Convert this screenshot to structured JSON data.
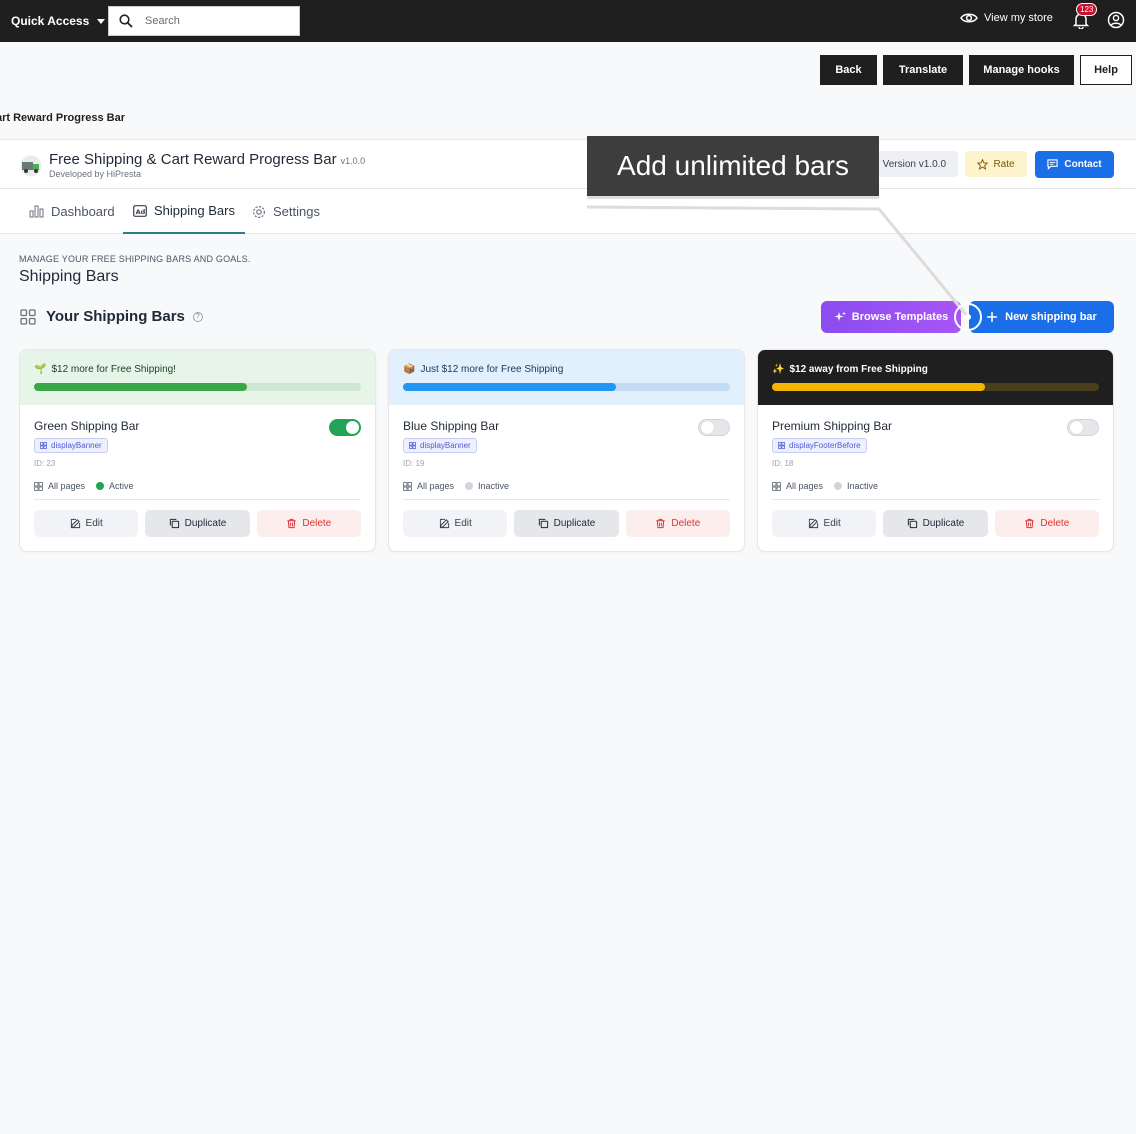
{
  "topbar": {
    "quick_access": "Quick Access",
    "search_placeholder": "Search",
    "view_store": "View my store",
    "notif_count": "123"
  },
  "toolbar": {
    "back": "Back",
    "translate": "Translate",
    "manage_hooks": "Manage hooks",
    "help": "Help"
  },
  "breadcrumb": "art Reward Progress Bar",
  "module": {
    "title": "Free Shipping & Cart Reward Progress Bar",
    "version": "v1.0.0",
    "developer": "Developed by HiPresta",
    "version_pill": "Version v1.0.0",
    "rate": "Rate",
    "contact": "Contact"
  },
  "tabs": [
    {
      "label": "Dashboard",
      "icon": "bar-chart-icon",
      "active": false
    },
    {
      "label": "Shipping Bars",
      "icon": "ad-icon",
      "active": true
    },
    {
      "label": "Settings",
      "icon": "gear-icon",
      "active": false
    }
  ],
  "section": {
    "kicker": "MANAGE YOUR FREE SHIPPING BARS AND GOALS.",
    "title": "Shipping Bars",
    "list_title": "Your Shipping Bars",
    "browse_templates": "Browse Templates",
    "new_bar": "New shipping bar"
  },
  "callout": "Add unlimited bars",
  "bars": [
    {
      "preview_text": "$12 more for Free Shipping!",
      "preview_emoji": "🌱",
      "progress": 0.65,
      "preview_bg": "#e6f5e8",
      "track_color": "#cfe6d2",
      "fill_color": "#3aa64a",
      "text_color": "#1f3d22",
      "name": "Green Shipping Bar",
      "hook": "displayBanner",
      "id": "ID: 23",
      "pages": "All pages",
      "status": "Active",
      "status_color": "#22a356",
      "enabled": true
    },
    {
      "preview_text": "Just $12 more for Free Shipping",
      "preview_emoji": "📦",
      "progress": 0.65,
      "preview_bg": "#e1f0fc",
      "track_color": "#c3dcf3",
      "fill_color": "#2196f3",
      "text_color": "#123a5e",
      "name": "Blue Shipping Bar",
      "hook": "displayBanner",
      "id": "ID: 19",
      "pages": "All pages",
      "status": "Inactive",
      "status_color": "#d1d5db",
      "enabled": false
    },
    {
      "preview_text": "$12 away from Free Shipping",
      "preview_emoji": "✨",
      "progress": 0.65,
      "preview_bg": "#1f1f1f",
      "track_color": "#4a3f1c",
      "fill_color": "#f4b400",
      "text_color": "#ffffff",
      "name": "Premium Shipping Bar",
      "hook": "displayFooterBefore",
      "id": "ID: 18",
      "pages": "All pages",
      "status": "Inactive",
      "status_color": "#d1d5db",
      "enabled": false
    }
  ],
  "card_actions": {
    "edit": "Edit",
    "duplicate": "Duplicate",
    "delete": "Delete"
  }
}
